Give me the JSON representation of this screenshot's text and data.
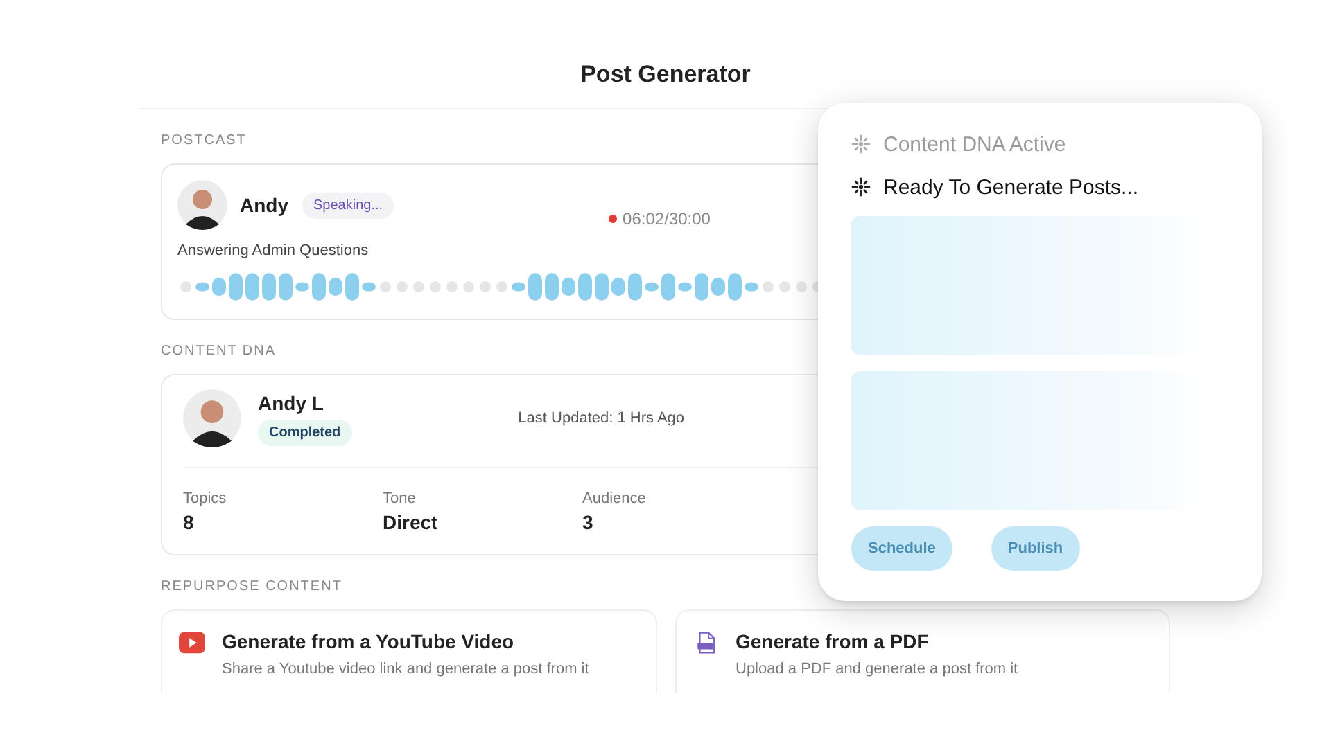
{
  "title": "Post Generator",
  "postcast": {
    "heading": "POSTCAST",
    "name": "Andy",
    "badge": "Speaking...",
    "recording": true,
    "timer": "06:02/30:00",
    "topic": "Answering Admin Questions"
  },
  "content_dna": {
    "heading": "CONTENT DNA",
    "name": "Andy L",
    "badge": "Completed",
    "updated": "Last Updated: 1 Hrs Ago",
    "stats": [
      {
        "label": "Topics",
        "value": "8"
      },
      {
        "label": "Tone",
        "value": "Direct"
      },
      {
        "label": "Audience",
        "value": "3"
      }
    ]
  },
  "repurpose": {
    "heading": "REPURPOSE CONTENT",
    "options": [
      {
        "kind": "youtube",
        "title": "Generate from a YouTube Video",
        "description": "Share a Youtube video link and generate a post from it"
      },
      {
        "kind": "pdf",
        "title": "Generate from a PDF",
        "description": "Upload a PDF and generate a post from it"
      }
    ]
  },
  "generator": {
    "statuses": [
      {
        "text": "Content DNA Active",
        "active": false
      },
      {
        "text": "Ready To Generate Posts...",
        "active": true
      }
    ],
    "buttons": [
      {
        "label": "Schedule",
        "disabled": true
      },
      {
        "label": "Publish",
        "disabled": true
      }
    ]
  }
}
